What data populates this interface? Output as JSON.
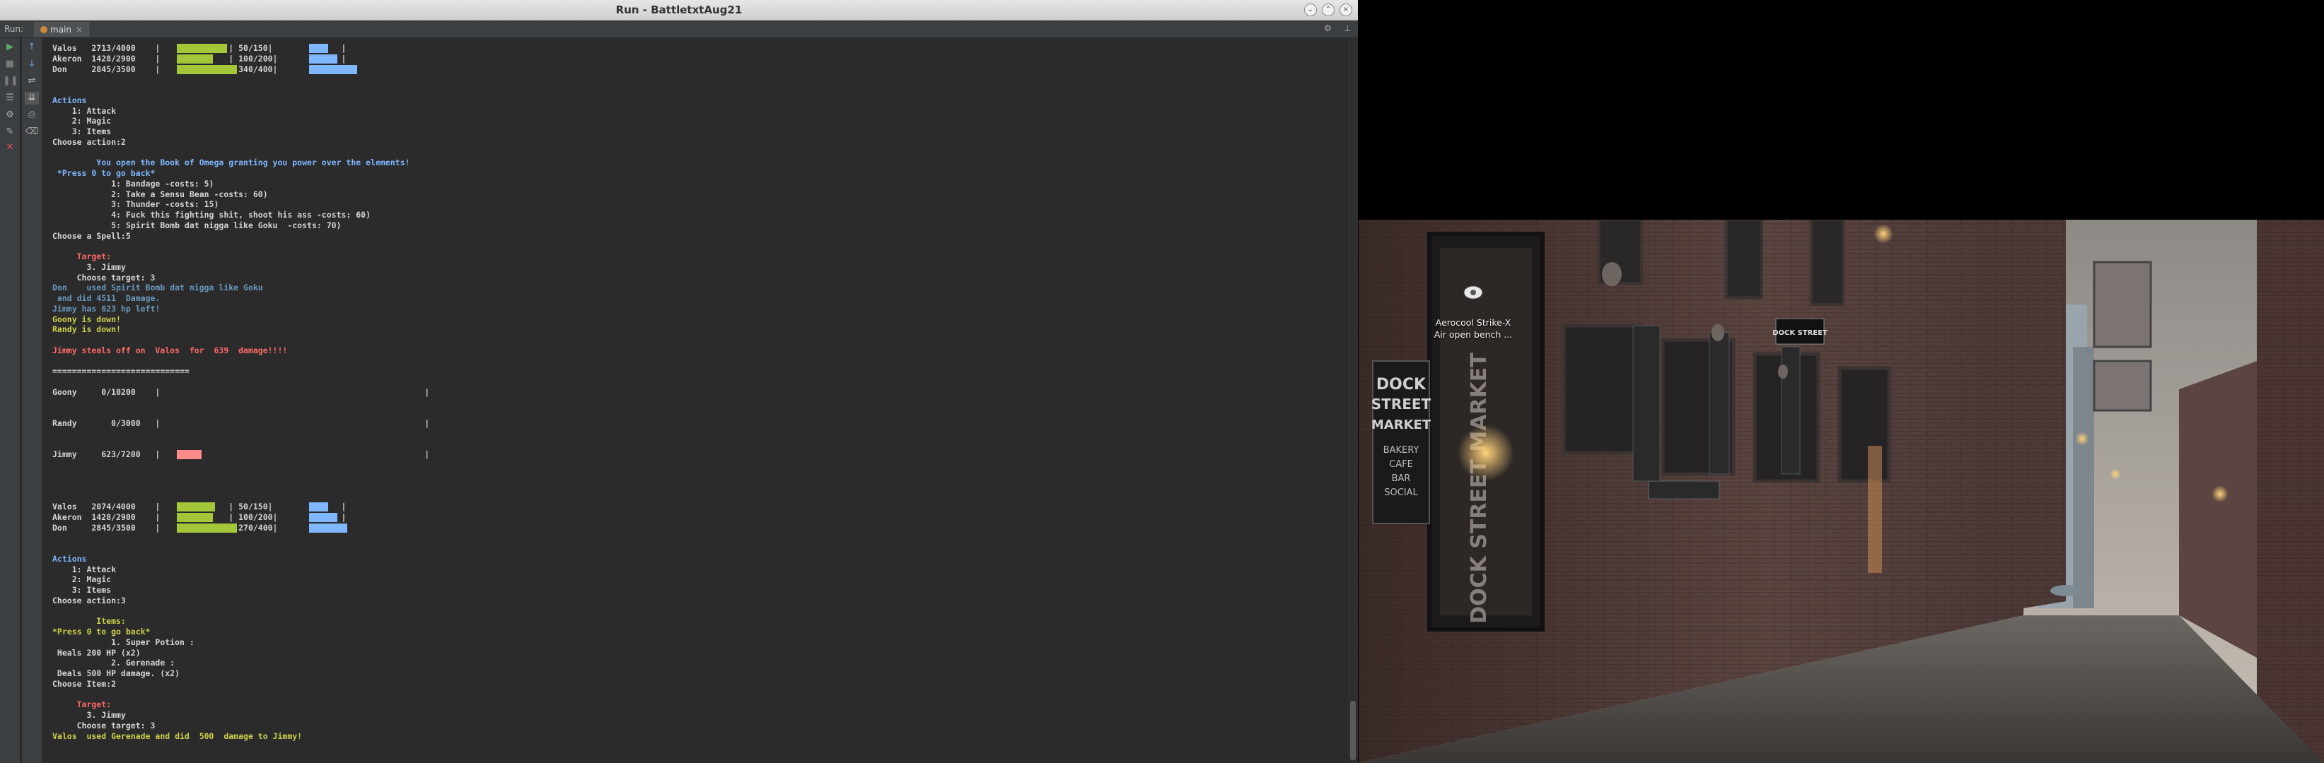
{
  "window": {
    "title": "Run - BattletxtAug21"
  },
  "run_panel": {
    "run_label": "Run:",
    "tab_label": "main",
    "tab_close": "×",
    "settings_glyph": "⚙",
    "minimize_glyph": "⊥"
  },
  "console": {
    "lines": [
      {
        "text": "Valos   2713/4000    |              | 50/150|              |",
        "cls": ""
      },
      {
        "text": "Akeron  1428/2900    |              | 100/200|             |",
        "cls": ""
      },
      {
        "text": "Don     2845/3500    |              | 340/400|             |",
        "cls": ""
      },
      {
        "text": "",
        "cls": ""
      },
      {
        "text": "",
        "cls": ""
      },
      {
        "text": "Actions",
        "cls": "lblue"
      },
      {
        "text": "    1: Attack",
        "cls": ""
      },
      {
        "text": "    2: Magic",
        "cls": ""
      },
      {
        "text": "    3: Items",
        "cls": ""
      },
      {
        "text": "Choose action:2",
        "cls": ""
      },
      {
        "text": "",
        "cls": ""
      },
      {
        "text": "         You open the Book of Omega granting you power over the elements!",
        "cls": "lblue"
      },
      {
        "text": " *Press 0 to go back*",
        "cls": "lblue"
      },
      {
        "text": "            1: Bandage -costs: 5)",
        "cls": ""
      },
      {
        "text": "            2: Take a Sensu Bean -costs: 60)",
        "cls": ""
      },
      {
        "text": "            3: Thunder -costs: 15)",
        "cls": ""
      },
      {
        "text": "            4: Fuck this fighting shit, shoot his ass -costs: 60)",
        "cls": ""
      },
      {
        "text": "            5: Spirit Bomb dat nigga like Goku  -costs: 70)",
        "cls": ""
      },
      {
        "text": "Choose a Spell:5",
        "cls": ""
      },
      {
        "text": "",
        "cls": ""
      },
      {
        "text": "     Target:",
        "cls": "red"
      },
      {
        "text": "       3. Jimmy",
        "cls": ""
      },
      {
        "text": "     Choose target: 3",
        "cls": ""
      },
      {
        "text": "Don    used Spirit Bomb dat nigga like Goku",
        "cls": "blue"
      },
      {
        "text": " and did 4511  Damage.",
        "cls": "blue"
      },
      {
        "text": "Jimmy has 623 hp left!",
        "cls": "blue"
      },
      {
        "text": "Goony is down!",
        "cls": "yellow"
      },
      {
        "text": "Randy is down!",
        "cls": "yellow"
      },
      {
        "text": "",
        "cls": ""
      },
      {
        "text": "Jimmy steals off on  Valos  for  639  damage!!!!",
        "cls": "red"
      },
      {
        "text": "",
        "cls": ""
      },
      {
        "text": "============================",
        "cls": ""
      },
      {
        "text": "",
        "cls": ""
      },
      {
        "text": "Goony     0/10200    |                                                      |",
        "cls": ""
      },
      {
        "text": "",
        "cls": ""
      },
      {
        "text": "",
        "cls": ""
      },
      {
        "text": "Randy       0/3000   |                                                      |",
        "cls": ""
      },
      {
        "text": "",
        "cls": ""
      },
      {
        "text": "",
        "cls": ""
      },
      {
        "text": "Jimmy     623/7200   |                                                      |",
        "cls": ""
      },
      {
        "text": "",
        "cls": ""
      },
      {
        "text": "",
        "cls": ""
      },
      {
        "text": "",
        "cls": ""
      },
      {
        "text": "",
        "cls": ""
      },
      {
        "text": "Valos   2074/4000    |              | 50/150|              |",
        "cls": ""
      },
      {
        "text": "Akeron  1428/2900    |              | 100/200|             |",
        "cls": ""
      },
      {
        "text": "Don     2845/3500    |              | 270/400|             |",
        "cls": ""
      },
      {
        "text": "",
        "cls": ""
      },
      {
        "text": "",
        "cls": ""
      },
      {
        "text": "Actions",
        "cls": "lblue"
      },
      {
        "text": "    1: Attack",
        "cls": ""
      },
      {
        "text": "    2: Magic",
        "cls": ""
      },
      {
        "text": "    3: Items",
        "cls": ""
      },
      {
        "text": "Choose action:3",
        "cls": ""
      },
      {
        "text": "",
        "cls": ""
      },
      {
        "text": "         Items:",
        "cls": "yellow"
      },
      {
        "text": "*Press 0 to go back*",
        "cls": "yellow"
      },
      {
        "text": "            1. Super Potion :",
        "cls": ""
      },
      {
        "text": " Heals 200 HP (x2)",
        "cls": ""
      },
      {
        "text": "            2. Gerenade :",
        "cls": ""
      },
      {
        "text": " Deals 500 HP damage. (x2)",
        "cls": ""
      },
      {
        "text": "Choose Item:2",
        "cls": ""
      },
      {
        "text": "",
        "cls": ""
      },
      {
        "text": "     Target:",
        "cls": "red"
      },
      {
        "text": "       3. Jimmy",
        "cls": ""
      },
      {
        "text": "     Choose target: 3",
        "cls": ""
      },
      {
        "text": "Valos  used Gerenade and did  500  damage to Jimmy!",
        "cls": "yellow"
      }
    ],
    "hp_bars": [
      {
        "line": 0,
        "hp_fraction": 0.678,
        "mp_fraction": 0.333
      },
      {
        "line": 1,
        "hp_fraction": 0.492,
        "mp_fraction": 0.5
      },
      {
        "line": 2,
        "hp_fraction": 0.813,
        "mp_fraction": 0.85
      },
      {
        "line": 44,
        "hp_fraction": 0.518,
        "mp_fraction": 0.333
      },
      {
        "line": 45,
        "hp_fraction": 0.492,
        "mp_fraction": 0.5
      },
      {
        "line": 46,
        "hp_fraction": 0.813,
        "mp_fraction": 0.675
      }
    ],
    "enemy_bars": [
      {
        "line": 39,
        "hp_fraction": 0.0865
      }
    ]
  },
  "desktop": {
    "icon_label_line1": "Aerocool Strike-X",
    "icon_label_line2": "Air open bench ..."
  },
  "photo_text": {
    "sign_line1": "DOCK",
    "sign_line2": "STREET",
    "sign_line3": "MARKET",
    "sign_sub1": "BAKERY",
    "sign_sub2": "CAFE",
    "sign_sub3": "BAR",
    "sign_sub4": "SOCIAL",
    "hanging_sign": "DOCK STREET",
    "window_big": "DOCK STREET MARKET"
  },
  "colors": {
    "hp_bar": "#a4c639",
    "mp_bar": "#7eb6ff",
    "enemy_bar": "#ff8a8a"
  }
}
